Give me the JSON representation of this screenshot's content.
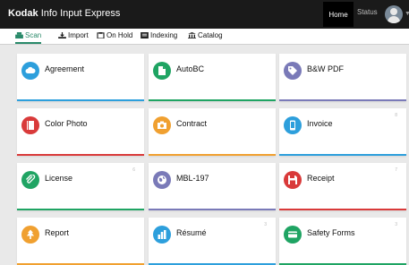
{
  "header": {
    "brand_bold": "Kodak",
    "brand_rest": "Info Input Express",
    "home_label": "Home",
    "status_label": "Status"
  },
  "nav": {
    "tabs": [
      {
        "label": "Scan",
        "icon": "scan-icon",
        "active": true
      },
      {
        "label": "Import",
        "icon": "import-icon"
      },
      {
        "label": "On Hold",
        "icon": "on-hold-icon"
      },
      {
        "label": "Indexing",
        "icon": "indexing-icon"
      },
      {
        "label": "Catalog",
        "icon": "catalog-icon"
      }
    ]
  },
  "colors": {
    "accent": "#2a8a6a",
    "sky": "#2d9fdc",
    "green": "#1fa463",
    "purple": "#7a7ab8",
    "red": "#d93a3a",
    "orange": "#f0a030",
    "darkred": "#d93a3a"
  },
  "tiles": [
    {
      "label": "Agreement",
      "icon": "cloud-icon",
      "color": "#2d9fdc",
      "num": ""
    },
    {
      "label": "AutoBC",
      "icon": "document-icon",
      "color": "#1fa463",
      "num": ""
    },
    {
      "label": "B&W PDF",
      "icon": "tag-icon",
      "color": "#7a7ab8",
      "num": ""
    },
    {
      "label": "Color Photo",
      "icon": "book-icon",
      "color": "#d93a3a",
      "num": ""
    },
    {
      "label": "Contract",
      "icon": "camera-icon",
      "color": "#f0a030",
      "num": ""
    },
    {
      "label": "Invoice",
      "icon": "phone-icon",
      "color": "#2d9fdc",
      "num": "8"
    },
    {
      "label": "License",
      "icon": "paperclip-icon",
      "color": "#1fa463",
      "num": "6"
    },
    {
      "label": "MBL-197",
      "icon": "globe-icon",
      "color": "#7a7ab8",
      "num": ""
    },
    {
      "label": "Receipt",
      "icon": "floppy-icon",
      "color": "#d93a3a",
      "num": "7"
    },
    {
      "label": "Report",
      "icon": "tree-icon",
      "color": "#f0a030",
      "num": ""
    },
    {
      "label": "Résumé",
      "icon": "bar-chart-icon",
      "color": "#2d9fdc",
      "num": "3"
    },
    {
      "label": "Safety Forms",
      "icon": "card-icon",
      "color": "#1fa463",
      "num": "3"
    }
  ]
}
